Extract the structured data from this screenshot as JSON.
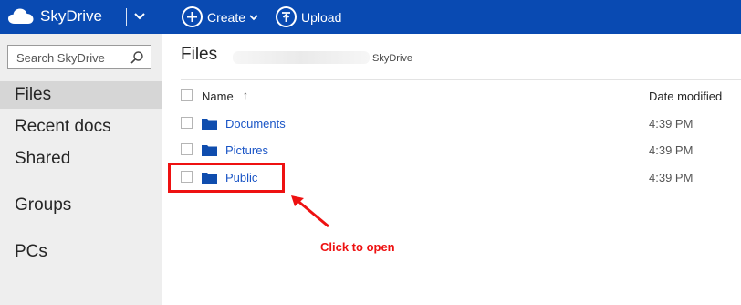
{
  "app": {
    "logo_text": "SkyDrive",
    "accent_color": "#094ab2",
    "icons": [
      "cloud-icon",
      "chevron-down-icon"
    ]
  },
  "toolbar": {
    "create_label": "Create",
    "upload_label": "Upload"
  },
  "sidebar": {
    "search_placeholder": "Search SkyDrive",
    "items": [
      {
        "label": "Files",
        "selected": true
      },
      {
        "label": "Recent docs",
        "selected": false
      },
      {
        "label": "Shared",
        "selected": false
      },
      {
        "label": "Groups",
        "selected": false
      },
      {
        "label": "PCs",
        "selected": false
      }
    ]
  },
  "main": {
    "title": "Files",
    "breadcrumb_tail": "SkyDrive",
    "columns": {
      "name": "Name",
      "sort_indicator": "↑",
      "date": "Date modified"
    },
    "rows": [
      {
        "name": "Documents",
        "date": "4:39 PM"
      },
      {
        "name": "Pictures",
        "date": "4:39 PM"
      },
      {
        "name": "Public",
        "date": "4:39 PM"
      }
    ]
  },
  "annotation": {
    "text": "Click to open",
    "color": "#ee1111"
  }
}
